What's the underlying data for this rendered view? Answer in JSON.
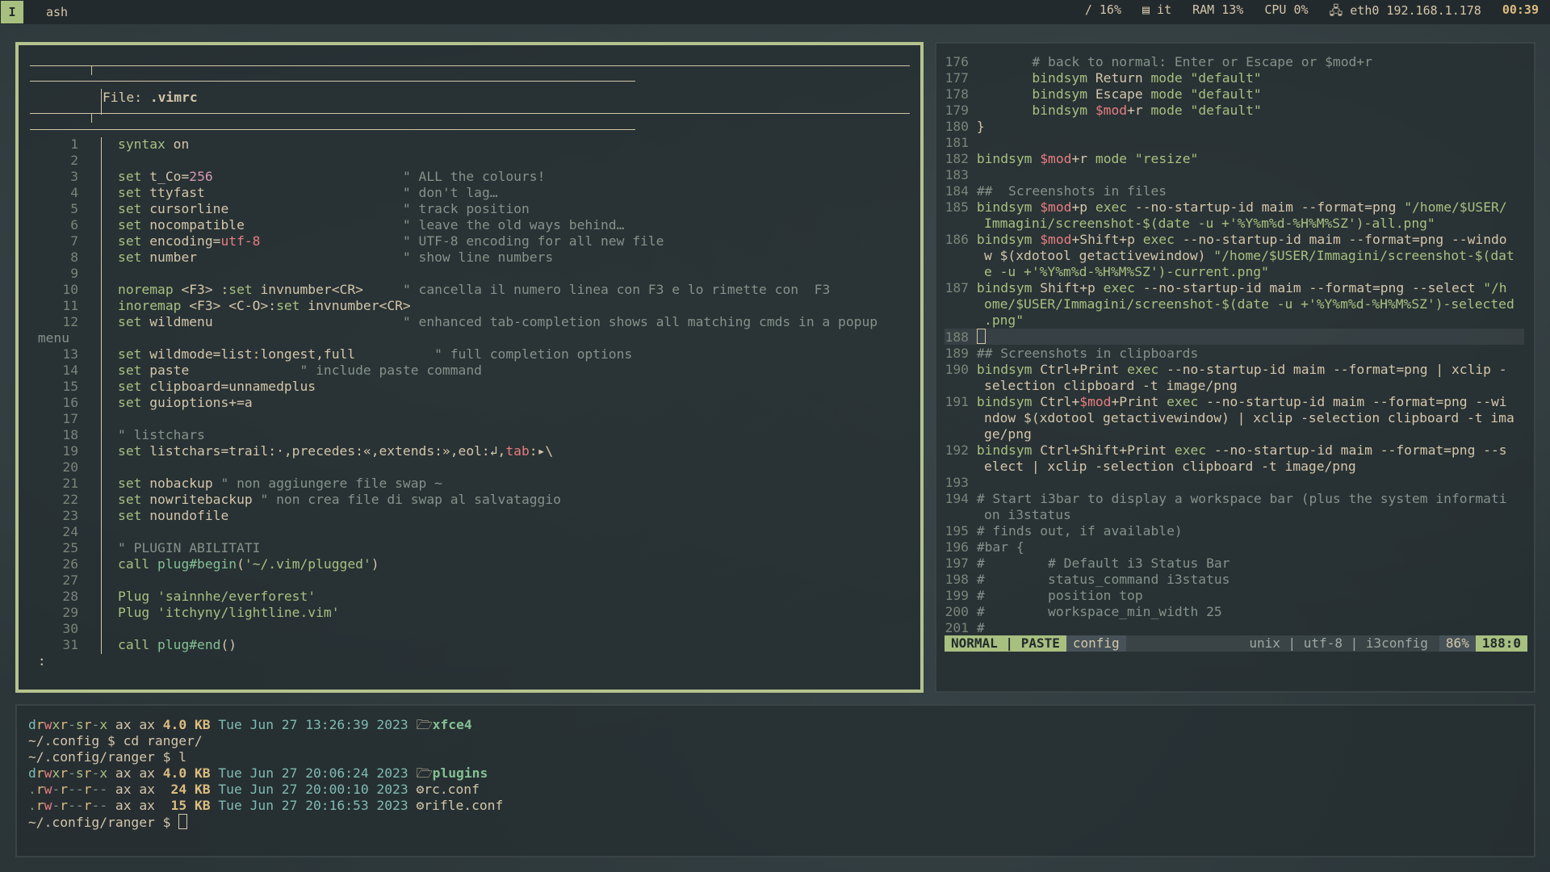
{
  "topbar": {
    "workspace": "I",
    "title": "ash",
    "disk": "/ 16%",
    "keyboard": "it",
    "ram": "RAM 13%",
    "cpu": "CPU  0%",
    "net": "eth0 192.168.1.178",
    "clock": "00:39"
  },
  "left_vim": {
    "header_label": "File: ",
    "header_file": ".vimrc",
    "overflow_word": "menu",
    "cmdline": ":"
  },
  "right_vim": {
    "status": {
      "mode": "NORMAL | PASTE",
      "filetype": "config",
      "info": "unix | utf-8 | i3config",
      "percent": "86%",
      "position": "188:0"
    }
  },
  "terminal": {
    "lines": [
      {
        "perm": "drwxr-sr-x",
        "owner": " ax ax ",
        "size": "4.0 KB",
        "date": " Tue Jun 27 13:26:39 2023 ",
        "icon": "folder",
        "name": "xfce4",
        "dir": true
      },
      {
        "prompt": "~/.config $ cd ranger/"
      },
      {
        "prompt": "~/.config/ranger $ l"
      },
      {
        "perm": "drwxr-sr-x",
        "owner": " ax ax ",
        "size": "4.0 KB",
        "date": " Tue Jun 27 20:06:24 2023 ",
        "icon": "folder",
        "name": "plugins",
        "dir": true
      },
      {
        "perm": ".rw-r--r--",
        "owner": " ax ax ",
        "size": " 24 KB",
        "date": " Tue Jun 27 20:00:10 2023 ",
        "icon": "gear",
        "name": "rc.conf",
        "dir": false
      },
      {
        "perm": ".rw-r--r--",
        "owner": " ax ax ",
        "size": " 15 KB",
        "date": " Tue Jun 27 20:16:53 2023 ",
        "icon": "gear",
        "name": "rifle.conf",
        "dir": false
      }
    ],
    "final_prompt": "~/.config/ranger $ "
  }
}
